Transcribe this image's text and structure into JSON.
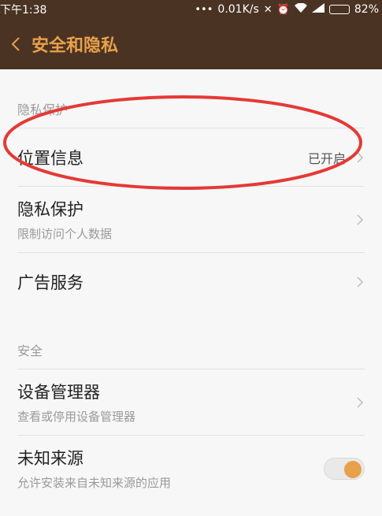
{
  "status_bar": {
    "time": "下午1:38",
    "network_speed": "0.01K/s",
    "battery": "82%"
  },
  "app_bar": {
    "title": "安全和隐私"
  },
  "sections": [
    {
      "header": "隐私保护",
      "rows": [
        {
          "label": "位置信息",
          "value": "已开启"
        },
        {
          "label": "隐私保护",
          "sub": "限制访问个人数据"
        },
        {
          "label": "广告服务"
        }
      ]
    },
    {
      "header": "安全",
      "rows": [
        {
          "label": "设备管理器",
          "sub": "查看或停用设备管理器"
        },
        {
          "label": "未知来源",
          "sub": "允许安装来自未知来源的应用",
          "toggle_on": true
        }
      ]
    }
  ],
  "colors": {
    "bar_bg": "#4a3322",
    "accent": "#e8a04a",
    "annotation": "#e53935"
  }
}
